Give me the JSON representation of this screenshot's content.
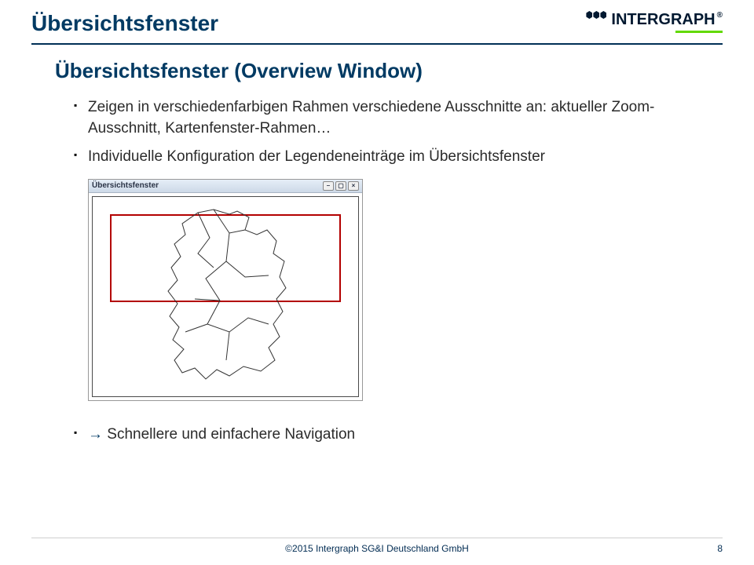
{
  "header": {
    "title": "Übersichtsfenster",
    "logo_text": "INTERGRAPH",
    "logo_reg": "®"
  },
  "content": {
    "subtitle": "Übersichtsfenster (Overview Window)",
    "bullet1": "Zeigen in verschiedenfarbigen Rahmen verschiedene Ausschnitte an: aktueller Zoom-Ausschnitt, Kartenfenster-Rahmen…",
    "bullet2": "Individuelle Konfiguration der Legendeneinträge im Übersichtsfenster",
    "screenshot_title": "Übersichtsfenster",
    "minimize": "–",
    "restore": "▢",
    "close": "×",
    "arrow": "→",
    "conclusion_text": " Schnellere und einfachere Navigation"
  },
  "footer": {
    "copyright": "©2015 Intergraph SG&I Deutschland GmbH",
    "page": "8"
  }
}
